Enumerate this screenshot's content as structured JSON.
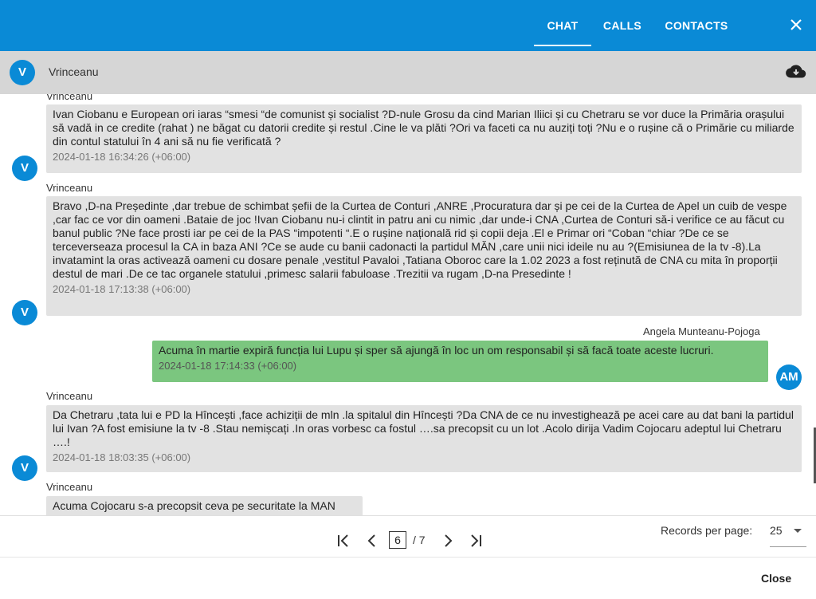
{
  "tabs": {
    "chat": "CHAT",
    "calls": "CALLS",
    "contacts": "CONTACTS"
  },
  "contact": {
    "initial": "V",
    "name": "Vrinceanu"
  },
  "messages": [
    {
      "sender": "Vrinceanu",
      "text": "Ivan Ciobanu e European ori iaras “smesi “de comunist și socialist ?D-nule Grosu da cind Marian Iliici și cu Chetraru se vor duce la Primăria orașului să vadă in ce credite (rahat ) ne băgat cu datorii credite și restul .Cine le va plăti ?Ori va faceti ca nu auziți toți ?Nu e o rușine că o Primărie cu miliarde din contul statului în 4 ani să nu fie verificată ?",
      "time": "2024-01-18 16:34:26 (+06:00)",
      "initial": "V"
    },
    {
      "sender": "Vrinceanu",
      "text": "Bravo ,D-na Președinte ,dar trebue de schimbat șefii de la Curtea de Conturi ,ANRE ,Procuratura dar și pe cei de la Curtea de Apel un cuib de vespe ,car fac ce vor din oameni .Bataie de joc !Ivan Ciobanu nu-i clintit in patru ani cu nimic ,dar unde-i CNA ,Curtea de Conturi să-i verifice ce au făcut cu banul public ?Ne face prosti iar pe cei de la PAS “impotenti “.E o rușine națională rid și copii deja .El e Primar ori “Coban “chiar ?De ce se terceverseaza procesul la CA in baza ANI ?Ce se aude cu banii cadonacti la partidul MĂN ,care unii nici ideile nu au ?(Emisiunea de la tv -8).La invatamint la oras activează oameni cu dosare penale ,vestitul Pavaloi ,Tatiana Oboroc care la 1.02 2023 a fost reținută de CNA cu mita în proporții destul de mari .De ce tac organele statului ,primesc salarii fabuloase .Trezitii va rugam ,D-na Presedinte !",
      "time": "2024-01-18 17:13:38 (+06:00)",
      "initial": "V"
    },
    {
      "sender": "Angela Munteanu-Pojoga",
      "text": "Acuma în martie expiră funcția lui Lupu și sper să ajungă în loc un om responsabil și să facă toate aceste lucruri.",
      "time": "2024-01-18 17:14:33 (+06:00)",
      "initial": "AM"
    },
    {
      "sender": "Vrinceanu",
      "text": "Da Chetraru ,tata lui e PD la Hîncești ,face achiziții de mln .la spitalul din Hîncești ?Da CNA de ce nu investighează pe acei care au dat bani la partidul lui Ivan ?A fost emisiune la tv -8 .Stau nemișcați .In oras vorbesc ca fostul ….sa precopsit cu un lot .Acolo dirija Vadim Cojocaru adeptul lui Chetraru ….!",
      "time": "2024-01-18 18:03:35 (+06:00)",
      "initial": "V"
    },
    {
      "sender": "Vrinceanu",
      "text": "Acuma Cojocaru s-a precopsit ceva pe securitate la MAN"
    }
  ],
  "top_sender_partial": "Vrinceanu",
  "pagination": {
    "current_page": "6",
    "total": "/ 7",
    "records_label": "Records per page:",
    "records_value": "25"
  },
  "footer": {
    "close_label": "Close"
  },
  "colors": {
    "brand": "#0a8ad6",
    "own_bubble": "#7bc67f",
    "other_bubble": "#e2e2e2"
  }
}
